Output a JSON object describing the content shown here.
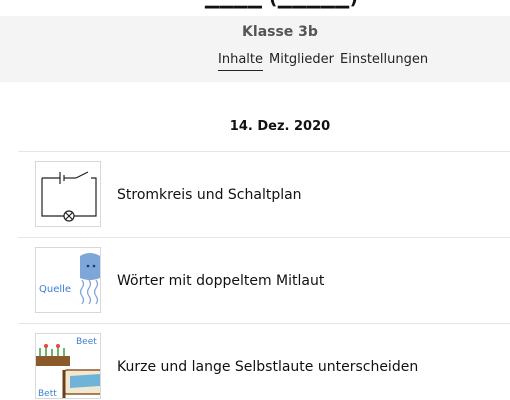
{
  "header": {
    "top_clipped": "▁▁▁▁ (▁▁▁▁▁)",
    "class_title": "Klasse 3b",
    "tabs": [
      {
        "label": "Inhalte",
        "active": true
      },
      {
        "label": "Mitglieder",
        "active": false
      },
      {
        "label": "Einstellungen",
        "active": false
      }
    ]
  },
  "date": "14. Dez. 2020",
  "items": [
    {
      "label": "Stromkreis und Schaltplan",
      "icon": "circuit-diagram-icon"
    },
    {
      "label": "Wörter mit doppeltem Mitlaut",
      "icon": "quelle-jellyfish-icon",
      "thumb_text": "Quelle"
    },
    {
      "label": "Kurze und lange Selbstlaute unterscheiden",
      "icon": "beet-bett-icon",
      "thumb_text_top": "Beet",
      "thumb_text_bottom": "Bett"
    }
  ],
  "colors": {
    "header_bg": "#f4f4f4",
    "accent_blue": "#3b7fd0",
    "divider": "#e6e6e6"
  }
}
